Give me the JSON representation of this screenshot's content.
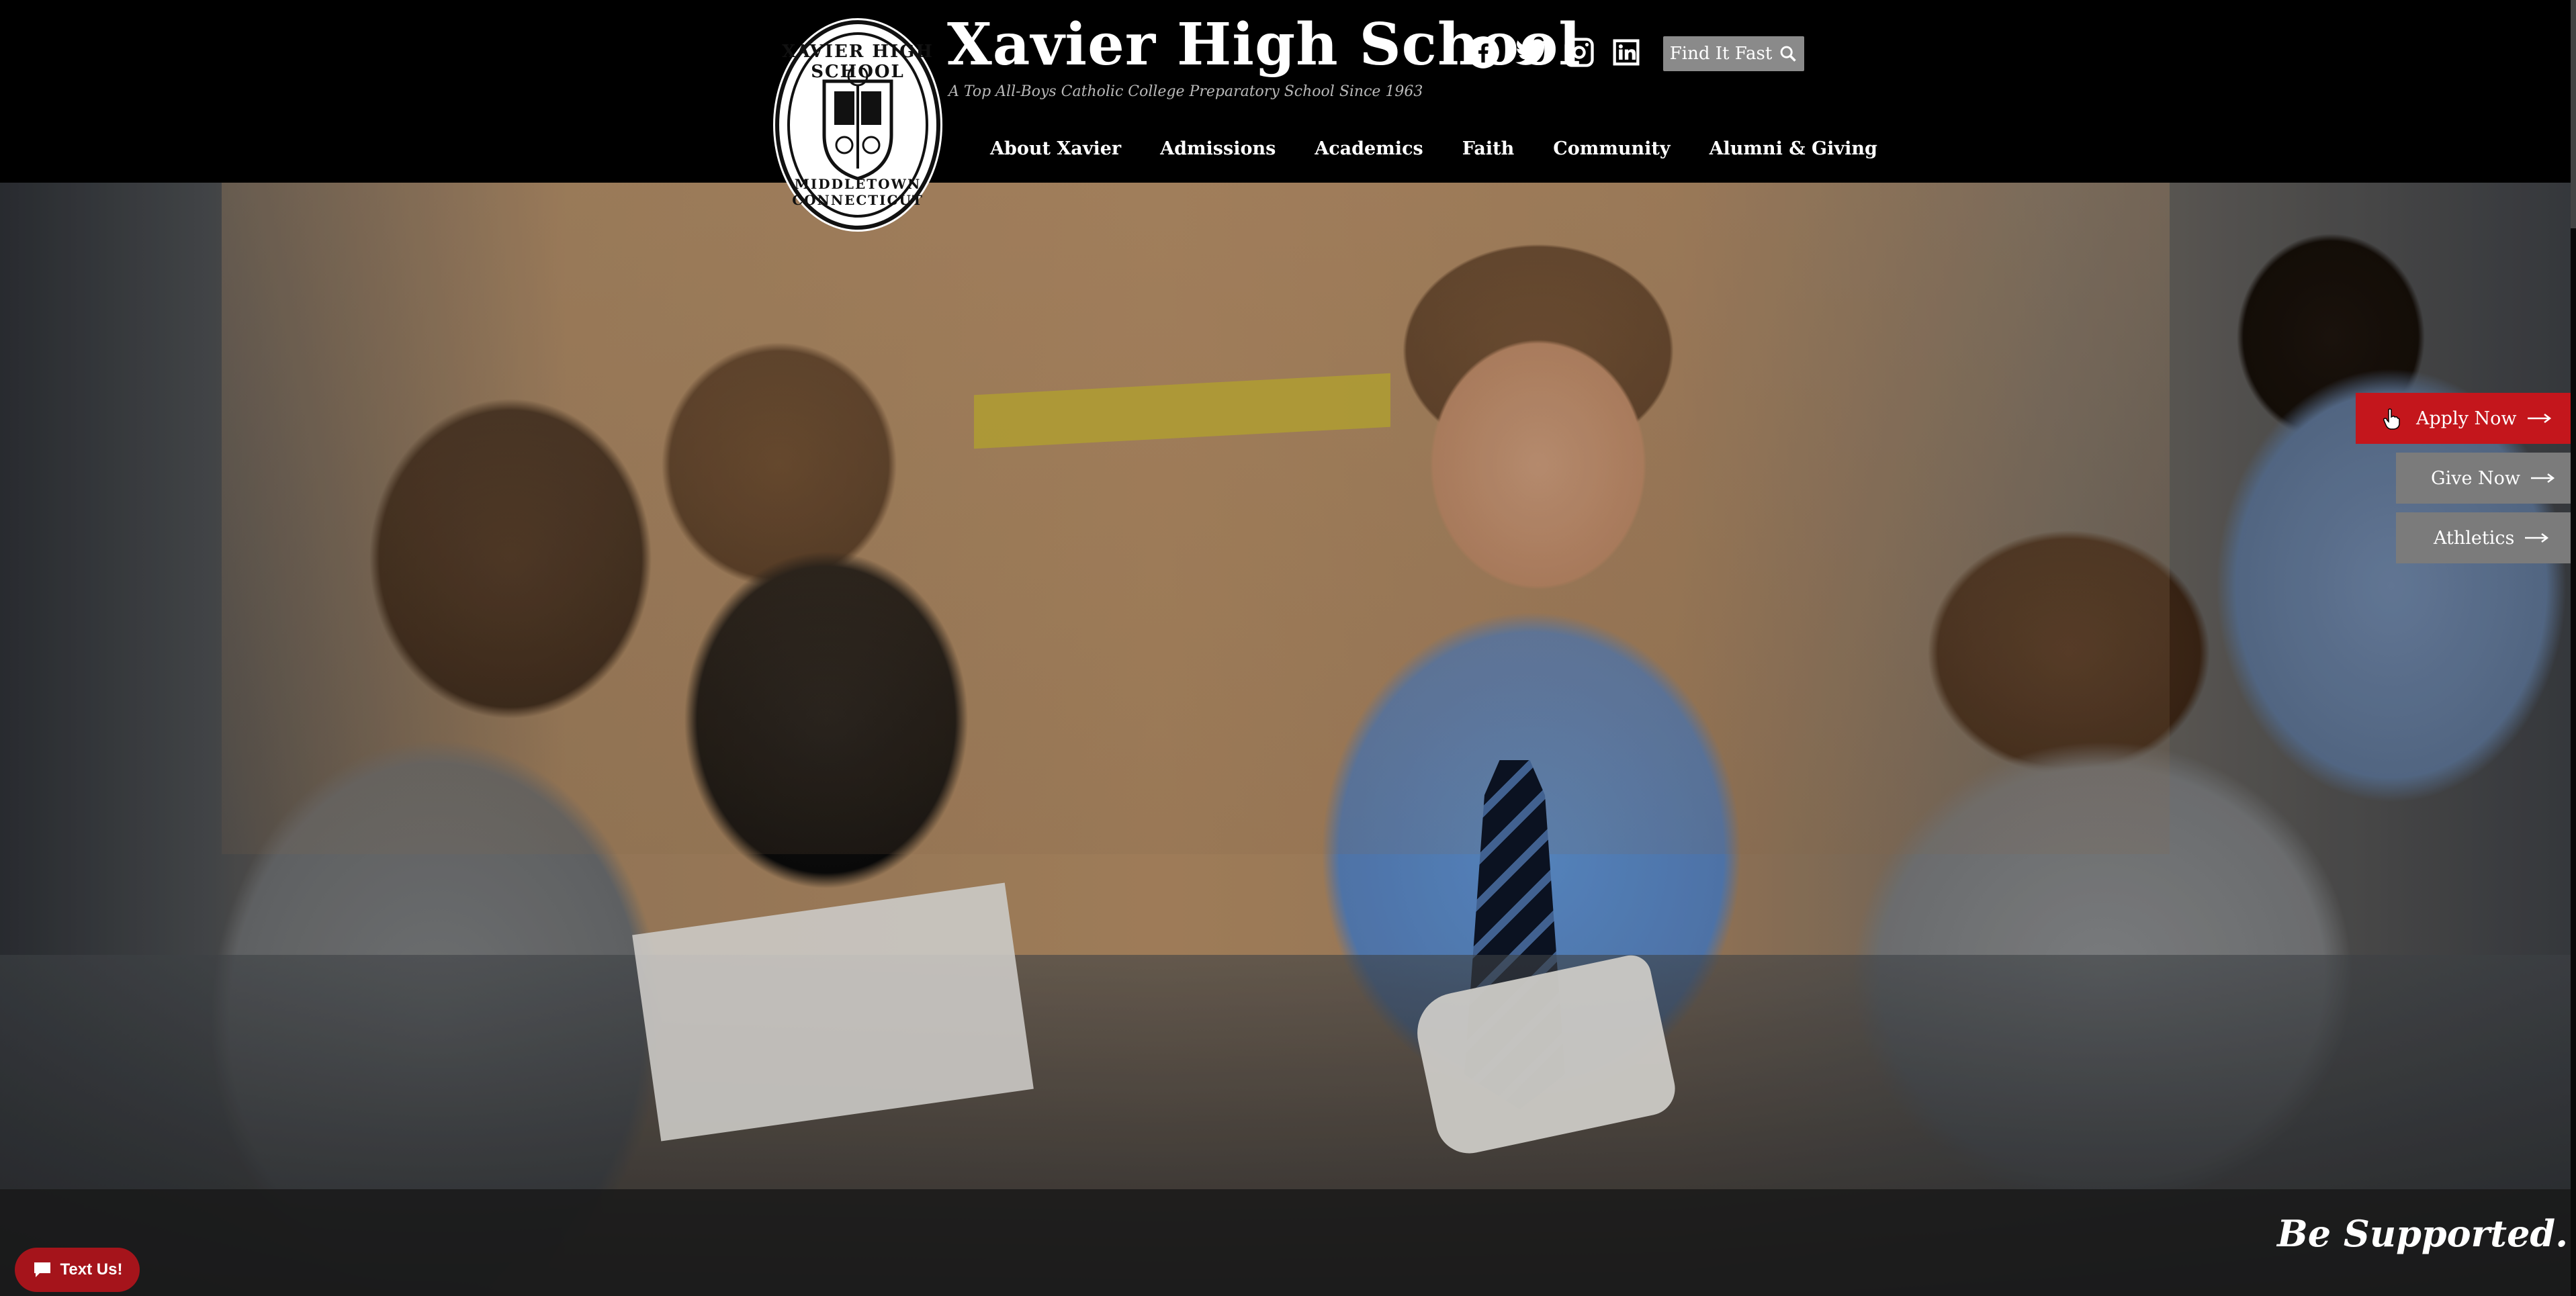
{
  "header": {
    "title": "Xavier High School",
    "tagline": "A Top All-Boys Catholic College Preparatory School Since 1963",
    "logo": {
      "top_text": "XAVIER HIGH SCHOOL",
      "bottom_text": "MIDDLETOWN CONNECTICUT",
      "icon": "school-crest-logo"
    },
    "social": [
      {
        "name": "facebook",
        "icon": "facebook-icon"
      },
      {
        "name": "twitter",
        "icon": "twitter-icon"
      },
      {
        "name": "instagram",
        "icon": "instagram-icon"
      },
      {
        "name": "linkedin",
        "icon": "linkedin-icon"
      }
    ],
    "find_fast": {
      "label": "Find It Fast",
      "icon": "search-icon"
    }
  },
  "nav": {
    "items": [
      "About Xavier",
      "Admissions",
      "Academics",
      "Faith",
      "Community",
      "Alumni & Giving"
    ]
  },
  "hero": {
    "banner_text": "Be Supported."
  },
  "cta": {
    "apply": "Apply Now",
    "give": "Give Now",
    "athletics": "Athletics",
    "arrow_icon": "long-arrow-right-icon"
  },
  "widget": {
    "text_us": "Text Us!",
    "icon": "chat-icon"
  },
  "colors": {
    "header_bg": "#000000",
    "apply_red": "#c4161c",
    "cta_gray": "#7b7b7b",
    "text_us_red": "#a5141b",
    "find_fast_gray": "#8a8a8a"
  }
}
